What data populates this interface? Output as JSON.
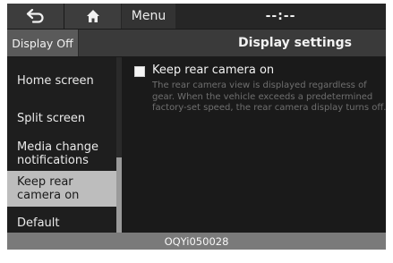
{
  "topbar": {
    "back_icon": "back-arrow-icon",
    "home_icon": "home-icon",
    "menu_label": "Menu",
    "time": "--:--"
  },
  "header": {
    "display_off_label": "Display Off",
    "title": "Display settings"
  },
  "sidebar": {
    "items": [
      {
        "label": "Home screen",
        "selected": false
      },
      {
        "label": "Split screen",
        "selected": false
      },
      {
        "label": "Media change notifications",
        "selected": false
      },
      {
        "label": "Keep rear camera on",
        "selected": true
      },
      {
        "label": "Default",
        "selected": false
      }
    ]
  },
  "content": {
    "option_label": "Keep rear camera on",
    "checked": false,
    "description": "The rear camera view is displayed regardless of gear. When the vehicle exceeds a predetermined factory-set speed, the rear camera display turns off."
  },
  "caption": "OQYi050028"
}
